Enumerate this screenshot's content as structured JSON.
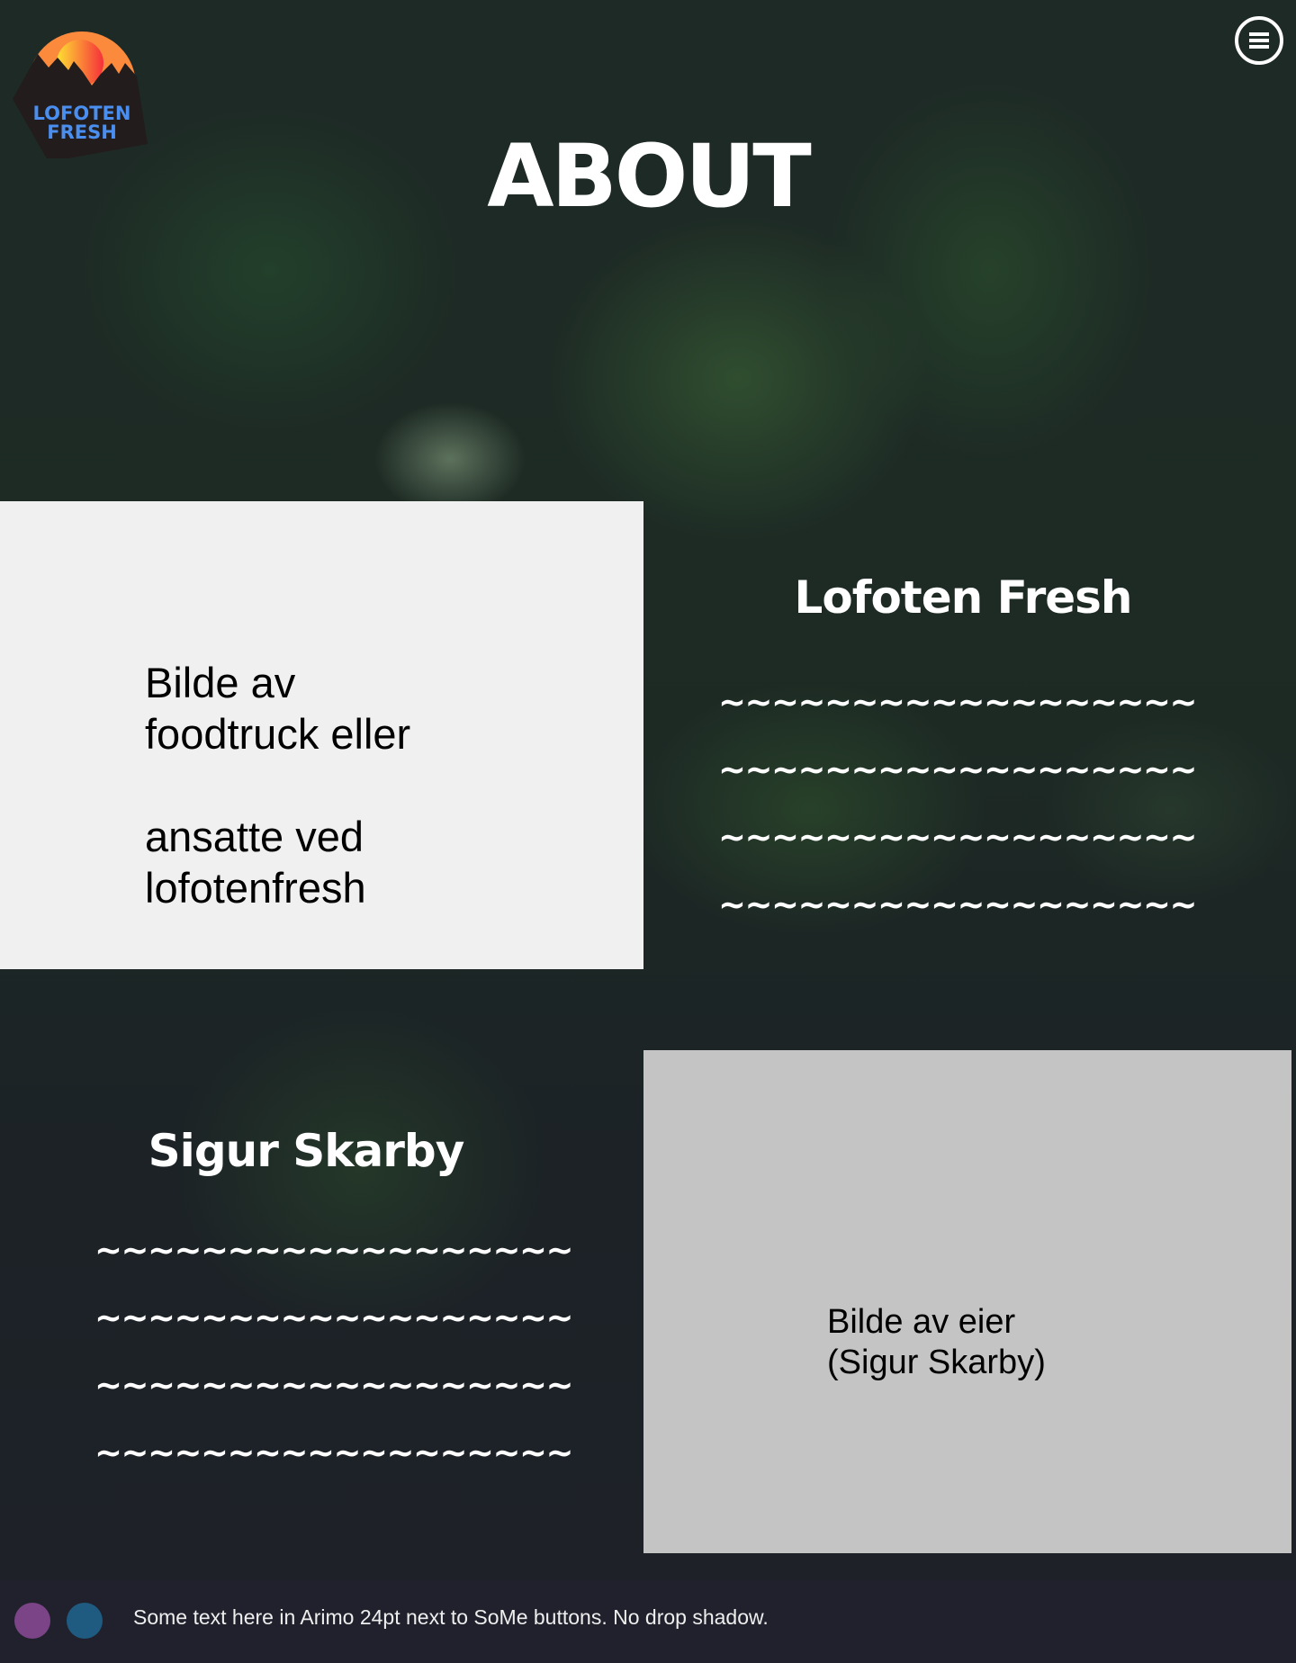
{
  "logo": {
    "text_line1": "LOFOTEN",
    "text_line2": "FRESH"
  },
  "header": {
    "title": "ABOUT",
    "menu_icon": "hamburger-menu-icon"
  },
  "section1": {
    "placeholder_text": "Bilde av\nfoodtruck eller\n\nansatte ved\nlofotenfresh",
    "heading": "Lofoten Fresh",
    "lines": [
      "~~~~~~~~~~~~~~~~~~",
      "~~~~~~~~~~~~~~~~~~",
      "~~~~~~~~~~~~~~~~~~",
      "~~~~~~~~~~~~~~~~~~"
    ]
  },
  "section2": {
    "heading": "Sigur Skarby",
    "lines": [
      "~~~~~~~~~~~~~~~~~~",
      "~~~~~~~~~~~~~~~~~~",
      "~~~~~~~~~~~~~~~~~~",
      "~~~~~~~~~~~~~~~~~~"
    ],
    "placeholder_text": "Bilde av eier\n(Sigur Skarby)"
  },
  "footer": {
    "text": "Some text here in Arimo 24pt next to SoMe buttons. No drop shadow.",
    "social": [
      {
        "name": "social-button-1",
        "color": "#7a4487"
      },
      {
        "name": "social-button-2",
        "color": "#1f5b80"
      }
    ]
  }
}
